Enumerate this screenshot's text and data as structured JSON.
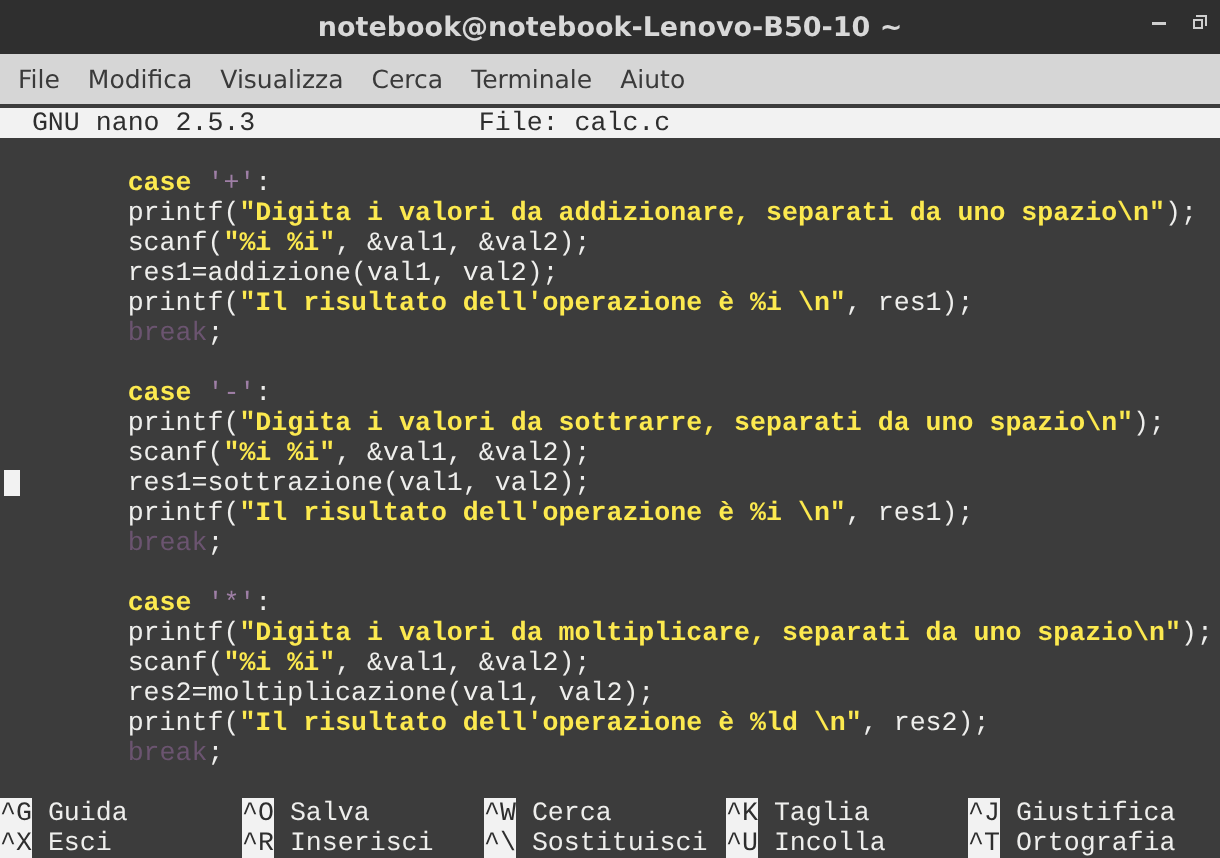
{
  "window": {
    "title": "notebook@notebook-Lenovo-B50-10 ~"
  },
  "menu": [
    "File",
    "Modifica",
    "Visualizza",
    "Cerca",
    "Terminale",
    "Aiuto"
  ],
  "nano_header": {
    "version": "GNU nano 2.5.3",
    "file": "File: calc.c"
  },
  "code_lines": [
    {
      "cursor": false
    },
    {
      "cursor": false,
      "tokens": [
        {
          "kind": "keyword",
          "text": "case"
        },
        {
          "kind": "char",
          "text": "'+'"
        },
        {
          "kind": "text",
          "text": ":"
        }
      ]
    },
    {
      "cursor": false,
      "tokens": [
        {
          "kind": "text",
          "text": "printf("
        },
        {
          "kind": "string",
          "text": "\"Digita i valori da addizionare, separati da uno spazio\\n\""
        },
        {
          "kind": "text",
          "text": ");"
        }
      ]
    },
    {
      "cursor": false,
      "tokens": [
        {
          "kind": "text",
          "text": "scanf("
        },
        {
          "kind": "string",
          "text": "\"%i %i\""
        },
        {
          "kind": "text",
          "text": ", &val1, &val2);"
        }
      ]
    },
    {
      "cursor": false,
      "tokens": [
        {
          "kind": "text",
          "text": "res1=addizione(val1, val2);"
        }
      ]
    },
    {
      "cursor": false,
      "tokens": [
        {
          "kind": "text",
          "text": "printf("
        },
        {
          "kind": "string",
          "text": "\"Il risultato dell'operazione è %i \\n\""
        },
        {
          "kind": "text",
          "text": ", res1);"
        }
      ]
    },
    {
      "cursor": false,
      "tokens": [
        {
          "kind": "flow",
          "text": "break"
        },
        {
          "kind": "text",
          "text": ";"
        }
      ]
    },
    {
      "cursor": false
    },
    {
      "cursor": false,
      "tokens": [
        {
          "kind": "keyword",
          "text": "case"
        },
        {
          "kind": "char",
          "text": "'-'"
        },
        {
          "kind": "text",
          "text": ":"
        }
      ]
    },
    {
      "cursor": false,
      "tokens": [
        {
          "kind": "text",
          "text": "printf("
        },
        {
          "kind": "string",
          "text": "\"Digita i valori da sottrarre, separati da uno spazio\\n\""
        },
        {
          "kind": "text",
          "text": ");"
        }
      ]
    },
    {
      "cursor": false,
      "tokens": [
        {
          "kind": "text",
          "text": "scanf("
        },
        {
          "kind": "string",
          "text": "\"%i %i\""
        },
        {
          "kind": "text",
          "text": ", &val1, &val2);"
        }
      ]
    },
    {
      "cursor": true,
      "tokens": [
        {
          "kind": "text",
          "text": "res1=sottrazione(val1, val2);"
        }
      ]
    },
    {
      "cursor": false,
      "tokens": [
        {
          "kind": "text",
          "text": "printf("
        },
        {
          "kind": "string",
          "text": "\"Il risultato dell'operazione è %i \\n\""
        },
        {
          "kind": "text",
          "text": ", res1);"
        }
      ]
    },
    {
      "cursor": false,
      "tokens": [
        {
          "kind": "flow",
          "text": "break"
        },
        {
          "kind": "text",
          "text": ";"
        }
      ]
    },
    {
      "cursor": false
    },
    {
      "cursor": false,
      "tokens": [
        {
          "kind": "keyword",
          "text": "case"
        },
        {
          "kind": "char",
          "text": "'*'"
        },
        {
          "kind": "text",
          "text": ":"
        }
      ]
    },
    {
      "cursor": false,
      "tokens": [
        {
          "kind": "text",
          "text": "printf("
        },
        {
          "kind": "string",
          "text": "\"Digita i valori da moltiplicare, separati da uno spazio\\n\""
        },
        {
          "kind": "text",
          "text": ");"
        }
      ]
    },
    {
      "cursor": false,
      "tokens": [
        {
          "kind": "text",
          "text": "scanf("
        },
        {
          "kind": "string",
          "text": "\"%i %i\""
        },
        {
          "kind": "text",
          "text": ", &val1, &val2);"
        }
      ]
    },
    {
      "cursor": false,
      "tokens": [
        {
          "kind": "text",
          "text": "res2=moltiplicazione(val1, val2);"
        }
      ]
    },
    {
      "cursor": false,
      "tokens": [
        {
          "kind": "text",
          "text": "printf("
        },
        {
          "kind": "string",
          "text": "\"Il risultato dell'operazione è %ld \\n\""
        },
        {
          "kind": "text",
          "text": ", res2);"
        }
      ]
    },
    {
      "cursor": false,
      "tokens": [
        {
          "kind": "flow",
          "text": "break"
        },
        {
          "kind": "text",
          "text": ";"
        }
      ]
    }
  ],
  "shortcuts": [
    [
      {
        "key": "^G",
        "label": "Guida"
      },
      {
        "key": "^O",
        "label": "Salva"
      },
      {
        "key": "^W",
        "label": "Cerca"
      },
      {
        "key": "^K",
        "label": "Taglia"
      },
      {
        "key": "^J",
        "label": "Giustifica"
      }
    ],
    [
      {
        "key": "^X",
        "label": "Esci"
      },
      {
        "key": "^R",
        "label": "Inserisci"
      },
      {
        "key": "^\\",
        "label": "Sostituisci"
      },
      {
        "key": "^U",
        "label": "Incolla"
      },
      {
        "key": "^T",
        "label": "Ortografia"
      }
    ]
  ]
}
